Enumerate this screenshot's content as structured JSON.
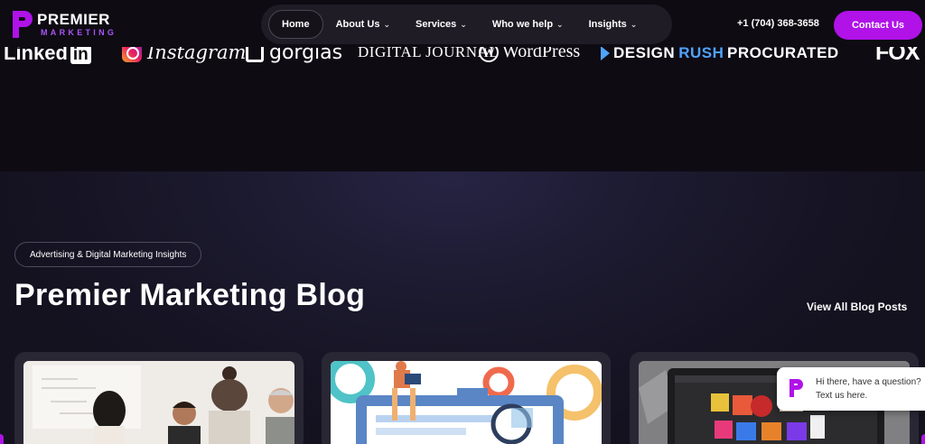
{
  "brand": {
    "name": "PREMIER",
    "sub": "MARKETING",
    "accent": "#b012e8",
    "accent_light": "#a855f7"
  },
  "nav": {
    "items": [
      {
        "label": "Home",
        "active": true,
        "dropdown": false
      },
      {
        "label": "About Us",
        "active": false,
        "dropdown": true
      },
      {
        "label": "Services",
        "active": false,
        "dropdown": true
      },
      {
        "label": "Who we help",
        "active": false,
        "dropdown": true
      },
      {
        "label": "Insights",
        "active": false,
        "dropdown": true
      }
    ],
    "chevron": "⌄"
  },
  "header": {
    "phone": "+1 (704) 368-3658",
    "contact_label": "Contact Us"
  },
  "press_logos": {
    "linkedin_text": "Linked",
    "linkedin_badge": "in",
    "instagram": "Instagram",
    "gorgias": "gorgias",
    "digital_journal": "DIGITAL JOURNAL",
    "wordpress_mark": "W",
    "wordpress": "WordPress",
    "designrush_a": "DESIGN",
    "designrush_b": "RUSH",
    "procurated": "PROCURATED",
    "fox": "FOX"
  },
  "blog": {
    "tag": "Advertising & Digital Marketing Insights",
    "title": "Premier Marketing Blog",
    "view_all": "View All Blog Posts"
  },
  "chat": {
    "line1": "Hi there, have a question?",
    "line2": "Text us here."
  }
}
